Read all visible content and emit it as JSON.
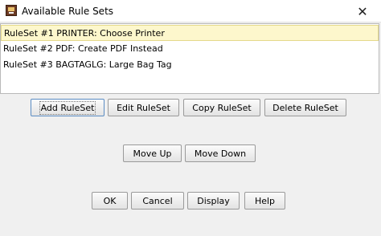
{
  "window": {
    "title": "Available Rule Sets",
    "close_glyph": "✕"
  },
  "rule_sets": [
    {
      "label": "RuleSet #1 PRINTER: Choose Printer",
      "selected": true
    },
    {
      "label": "RuleSet #2 PDF: Create PDF Instead",
      "selected": false
    },
    {
      "label": "RuleSet #3 BAGTAGLG: Large Bag Tag",
      "selected": false
    }
  ],
  "buttons": {
    "add": "Add RuleSet",
    "edit": "Edit RuleSet",
    "copy": "Copy RuleSet",
    "delete": "Delete RuleSet",
    "move_up": "Move Up",
    "move_down": "Move Down",
    "ok": "OK",
    "cancel": "Cancel",
    "display": "Display",
    "help": "Help"
  },
  "colors": {
    "selection_background": "#fdf7cc",
    "window_background": "#f0f0f0"
  },
  "icons": {
    "app": "app-logo-icon",
    "close": "close-icon"
  }
}
